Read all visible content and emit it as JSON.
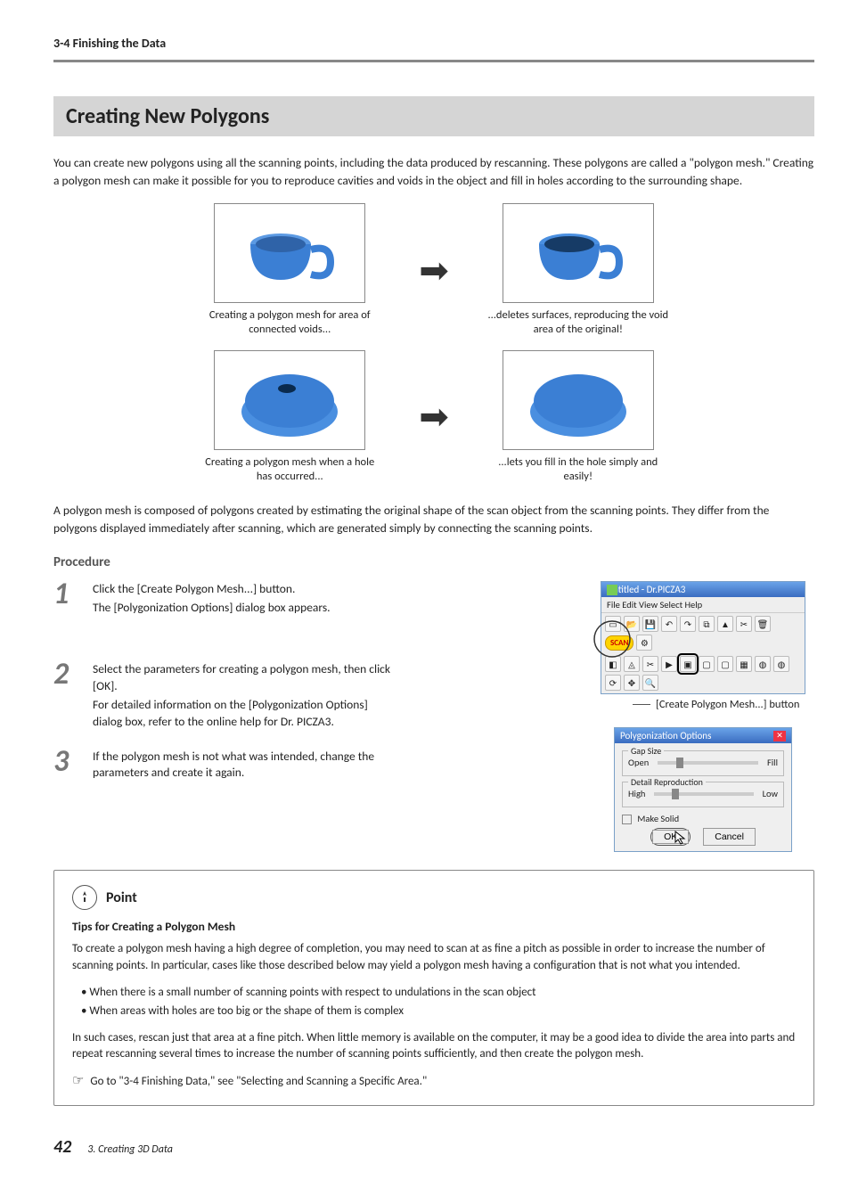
{
  "section_path": "3-4 Finishing the Data",
  "heading": "Creating New Polygons",
  "intro": "You can create new polygons using all the scanning points, including the data produced by rescanning. These polygons are called a \"polygon mesh.\" Creating a polygon mesh can make it possible for you to reproduce cavities and voids in the object and fill in holes according to the surrounding shape.",
  "illus": {
    "row1": {
      "left_caption": "Creating a polygon mesh for area of connected voids...",
      "right_caption": "...deletes surfaces, reproducing the void area of the original!"
    },
    "row2": {
      "left_caption": "Creating a polygon mesh when a hole has occurred...",
      "right_caption": "...lets you fill in the hole simply and easily!"
    }
  },
  "mid_p": "A polygon mesh is composed of polygons created by estimating the original shape of the scan object from the scanning points. They differ from the polygons displayed immediately after scanning, which are generated simply by connecting the scanning points.",
  "procedure_label": "Procedure",
  "steps": {
    "s1": {
      "num": "1",
      "inst": "Click the [Create Polygon Mesh...] button.",
      "sub": "The [Polygonization Options] dialog box appears."
    },
    "s2": {
      "num": "2",
      "inst": "Select the parameters for creating a polygon mesh, then click [OK].",
      "sub": "For detailed information on the [Polygonization Options] dialog box, refer to the online help for Dr. PICZA3."
    },
    "s3": {
      "num": "3",
      "inst": "If the polygon mesh is not what was intended, change the parameters and create it again."
    }
  },
  "app": {
    "title": "Untitled - Dr.PICZA3",
    "menu": "File   Edit   View   Select   Help",
    "scan": "SCAN",
    "callout": "[Create Polygon Mesh...] button"
  },
  "dialog": {
    "title": "Polygonization Options",
    "grp1": {
      "legend": "Gap Size",
      "left": "Open",
      "right": "Fill"
    },
    "grp2": {
      "legend": "Detail Reproduction",
      "left": "High",
      "right": "Low"
    },
    "chk": "Make Solid",
    "ok": "OK",
    "cancel": "Cancel"
  },
  "point": {
    "label": "Point",
    "sub": "Tips for Creating a Polygon Mesh",
    "p1": "To create a polygon mesh having a high degree of completion, you may need to scan at as fine a pitch as possible in order to increase the number of scanning points. In particular, cases like those described below may yield a polygon mesh having a configuration that is not what you intended.",
    "b1": "• When there is a small number of scanning points with respect to undulations in the scan object",
    "b2": "• When areas with holes are too big or the shape of them is complex",
    "p2": "In such cases, rescan just that area at a fine pitch. When little memory is available on the computer, it may be a good idea to divide the area into parts and repeat rescanning several times to increase the number of scanning points sufficiently, and then create the polygon mesh.",
    "xref": "Go to \"3-4 Finishing Data,\" see \"Selecting and Scanning a Specific Area.\""
  },
  "footer": {
    "page": "42",
    "chapter": "3. Creating 3D Data"
  }
}
